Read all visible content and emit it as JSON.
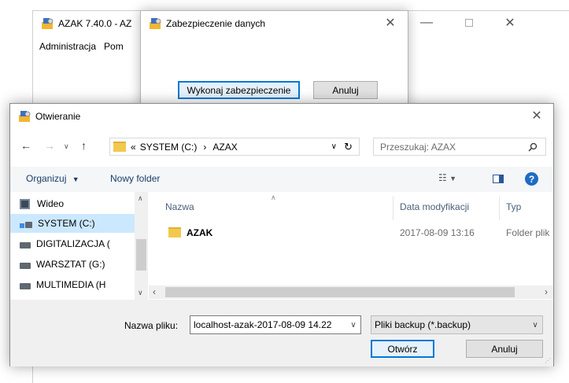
{
  "main_window": {
    "title": "AZAK 7.40.0 - AZ",
    "menu": [
      "Administracja",
      "Pom"
    ]
  },
  "backup_dialog": {
    "title": "Zabezpieczenie danych",
    "run_button": "Wykonaj zabezpieczenie",
    "cancel_button": "Anuluj"
  },
  "open_dialog": {
    "title": "Otwieranie",
    "address": {
      "prefix": "«",
      "segments": [
        "SYSTEM (C:)",
        "AZAX"
      ]
    },
    "search_placeholder": "Przeszukaj: AZAX",
    "toolbar": {
      "organize": "Organizuj",
      "new_folder": "Nowy folder"
    },
    "nav_items": [
      {
        "label": "Wideo",
        "icon": "video-icon"
      },
      {
        "label": "SYSTEM (C:)",
        "icon": "system-drive-icon"
      },
      {
        "label": "DIGITALIZACJA (",
        "icon": "drive-icon"
      },
      {
        "label": "WARSZTAT (G:)",
        "icon": "drive-icon"
      },
      {
        "label": "MULTIMEDIA (H",
        "icon": "drive-icon"
      }
    ],
    "columns": {
      "name": "Nazwa",
      "modified": "Data modyfikacji",
      "type": "Typ"
    },
    "files": [
      {
        "name": "AZAK",
        "modified": "2017-08-09 13:16",
        "type": "Folder plik"
      }
    ],
    "filename_label": "Nazwa pliku:",
    "filename_value": "localhost-azak-2017-08-09 14.22",
    "filter_value": "Pliki backup (*.backup)",
    "open_button": "Otwórz",
    "cancel_button": "Anuluj"
  }
}
